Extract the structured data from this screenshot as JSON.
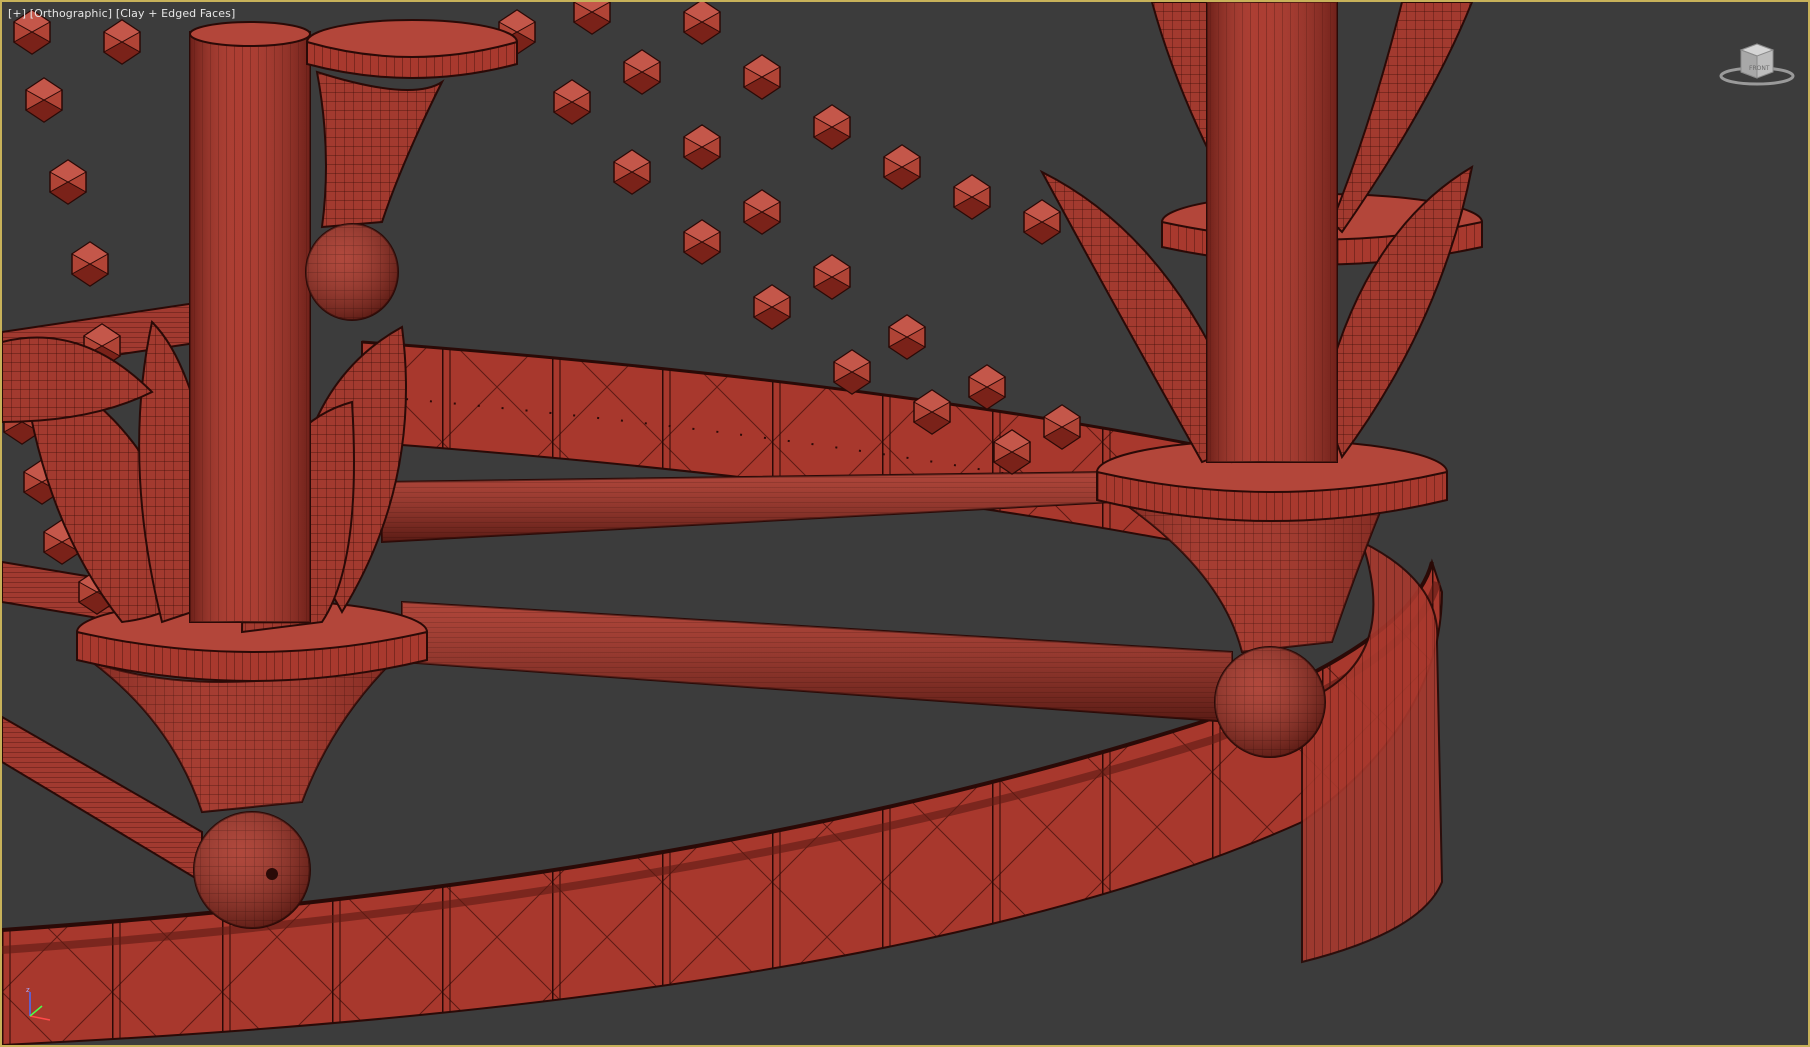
{
  "viewport": {
    "label_plus": "[+]",
    "label_view": "[Orthographic]",
    "label_shading": "[Clay + Edged Faces]"
  },
  "viewcube": {
    "face_label": "FRONT",
    "icon": "viewcube-icon"
  },
  "axis_tripod": {
    "z_label": "z",
    "x_label": "x",
    "y_label": "y"
  },
  "colors": {
    "background": "#3c3c3c",
    "border_active": "#c8b25a",
    "clay": "#a33a30",
    "clay_dark": "#5e1a14",
    "clay_light": "#c65a4c",
    "wire": "#2a0a07"
  }
}
